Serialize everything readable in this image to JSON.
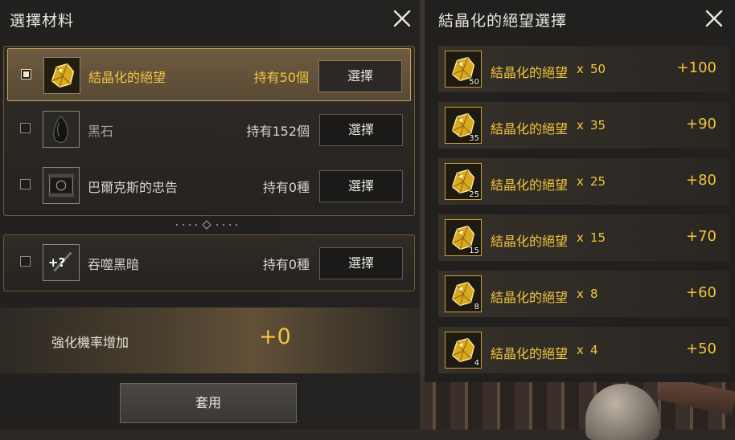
{
  "left_panel": {
    "title": "選擇材料",
    "materials": [
      {
        "name": "結晶化的絕望",
        "owned": "持有50個",
        "button": "選擇",
        "checked": true,
        "icon": "crystal-despair-icon"
      },
      {
        "name": "黑石",
        "owned": "持有152個",
        "button": "選擇",
        "checked": false,
        "icon": "black-stone-icon"
      },
      {
        "name": "巴爾克斯的忠告",
        "owned": "持有0種",
        "button": "選擇",
        "checked": false,
        "icon": "scroll-icon"
      }
    ],
    "special": {
      "name": "吞噬黑暗",
      "owned": "持有0種",
      "button": "選擇",
      "checked": false,
      "icon": "dark-devour-icon"
    },
    "rate_label": "強化機率增加",
    "rate_value": "+0",
    "apply_label": "套用"
  },
  "right_panel": {
    "title": "結晶化的絕望選擇",
    "options": [
      {
        "label": "結晶化的絕望",
        "x": "x",
        "qty": "50",
        "count": "50",
        "bonus": "+100"
      },
      {
        "label": "結晶化的絕望",
        "x": "x",
        "qty": "35",
        "count": "35",
        "bonus": "+90"
      },
      {
        "label": "結晶化的絕望",
        "x": "x",
        "qty": "25",
        "count": "25",
        "bonus": "+80"
      },
      {
        "label": "結晶化的絕望",
        "x": "x",
        "qty": "15",
        "count": "15",
        "bonus": "+70"
      },
      {
        "label": "結晶化的絕望",
        "x": "x",
        "qty": "8",
        "count": "8",
        "bonus": "+60"
      },
      {
        "label": "結晶化的絕望",
        "x": "x",
        "qty": "4",
        "count": "4",
        "bonus": "+50"
      }
    ]
  },
  "colors": {
    "accent_gold": "#f2c53d",
    "panel_bg": "#222120",
    "border_bronze": "#6e5a37"
  }
}
